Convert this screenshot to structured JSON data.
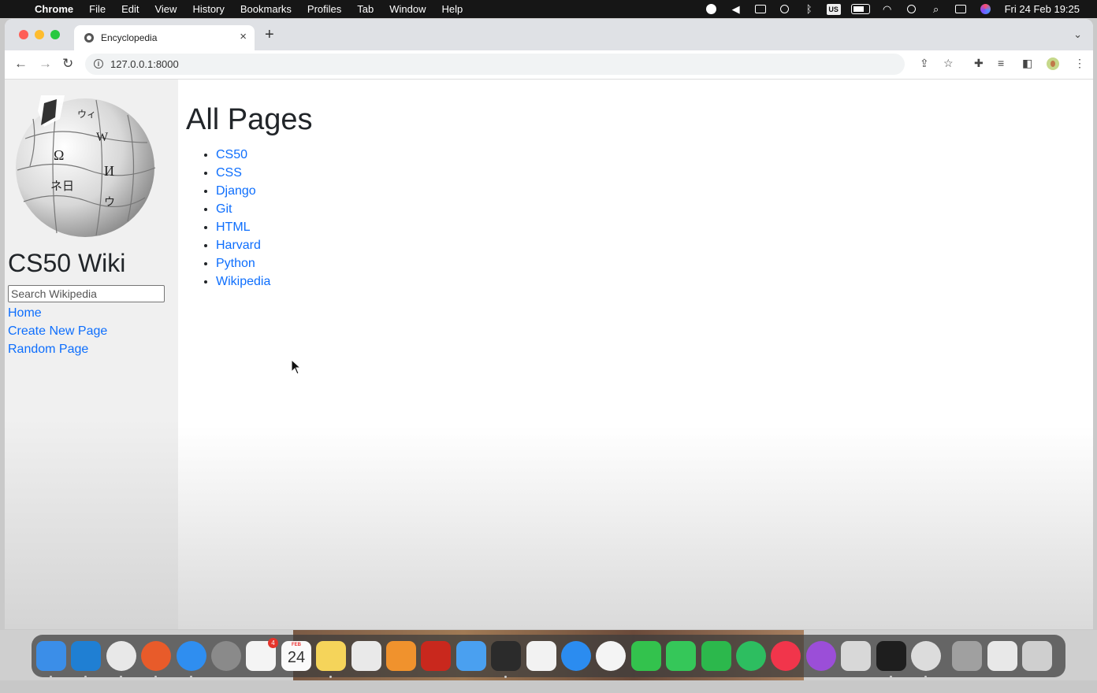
{
  "menubar": {
    "app_name": "Chrome",
    "items": [
      "File",
      "Edit",
      "View",
      "History",
      "Bookmarks",
      "Profiles",
      "Tab",
      "Window",
      "Help"
    ],
    "input_source": "US",
    "clock": "Fri 24 Feb  19:25"
  },
  "browser": {
    "tab_title": "Encyclopedia",
    "url": "127.0.0.1:8000"
  },
  "sidebar": {
    "title": "CS50 Wiki",
    "search_placeholder": "Search Wikipedia",
    "links": [
      "Home",
      "Create New Page",
      "Random Page"
    ]
  },
  "main": {
    "heading": "All Pages",
    "entries": [
      "CS50",
      "CSS",
      "Django",
      "Git",
      "HTML",
      "Harvard",
      "Python",
      "Wikipedia"
    ]
  },
  "dock": {
    "calendar_month": "FEB",
    "calendar_day": "24",
    "reminders_badge": "4",
    "apps": [
      {
        "icon": "finder-icon",
        "color": "#3b8ee8"
      },
      {
        "icon": "vscode-icon",
        "color": "#1f7fd3"
      },
      {
        "icon": "chrome-icon",
        "color": "#e8e8e8"
      },
      {
        "icon": "firefox-icon",
        "color": "#e85b2a"
      },
      {
        "icon": "safari-icon",
        "color": "#2f8ef0"
      },
      {
        "icon": "system-preferences-icon",
        "color": "#8a8a8a"
      },
      {
        "icon": "reminders-icon",
        "color": "#f4f4f4"
      },
      {
        "icon": "calendar-icon",
        "color": "#fafafa"
      },
      {
        "icon": "notes-icon",
        "color": "#f5d45a"
      },
      {
        "icon": "textedit-icon",
        "color": "#e9e9e9"
      },
      {
        "icon": "pages-icon",
        "color": "#f0922d"
      },
      {
        "icon": "acrobat-icon",
        "color": "#c9281d"
      },
      {
        "icon": "mail-icon",
        "color": "#4aa0f0"
      },
      {
        "icon": "activity-monitor-icon",
        "color": "#2b2b2b"
      },
      {
        "icon": "app-icon",
        "color": "#f2f2f2"
      },
      {
        "icon": "app-store-icon",
        "color": "#2b8cf0"
      },
      {
        "icon": "photos-icon",
        "color": "#f4f4f4"
      },
      {
        "icon": "facetime-icon",
        "color": "#33c24d"
      },
      {
        "icon": "messages-icon",
        "color": "#35c759"
      },
      {
        "icon": "numbers-icon",
        "color": "#2cb84c"
      },
      {
        "icon": "evernote-icon",
        "color": "#2dbe60"
      },
      {
        "icon": "music-icon",
        "color": "#f1354b"
      },
      {
        "icon": "podcasts-icon",
        "color": "#9b4ed8"
      },
      {
        "icon": "launchpad-icon",
        "color": "#d8d8d8"
      },
      {
        "icon": "terminal-icon",
        "color": "#1e1e1e"
      },
      {
        "icon": "quicktime-icon",
        "color": "#dcdcdc"
      },
      {
        "icon": "downloads-icon",
        "color": "#a0a0a0"
      },
      {
        "icon": "documents-icon",
        "color": "#e8e8e8"
      },
      {
        "icon": "trash-icon",
        "color": "#cfcfcf"
      }
    ]
  }
}
